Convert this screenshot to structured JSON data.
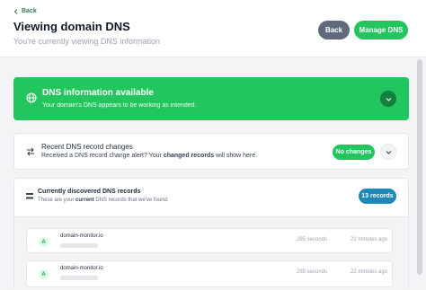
{
  "header": {
    "back_link": "Back",
    "title": "Viewing domain DNS",
    "subtitle": "You're currently viewing DNS information",
    "back_button": "Back",
    "manage_button": "Manage DNS"
  },
  "banner": {
    "title": "DNS information available",
    "text": "Your domain's DNS appears to be working as intended.",
    "color": "#22c55e",
    "icon": "globe-icon"
  },
  "changes": {
    "title": "Recent DNS record changes",
    "text_before": "Received a DNS record change alert? Your ",
    "text_bold": "changed records",
    "text_after": " will show here.",
    "pill": "No changes",
    "icon": "swap-arrows-icon"
  },
  "records": {
    "title": "Currently discovered DNS records",
    "text_before": "These are your ",
    "text_bold": "current",
    "text_after": " DNS records that we've found.",
    "count_pill": "13 records",
    "icon": "list-icon",
    "items": [
      {
        "type": "A",
        "host": "domain-monitor.io",
        "ttl": "285 seconds",
        "ago": "22 minutes ago"
      },
      {
        "type": "A",
        "host": "domain-monitor.io",
        "ttl": "285 seconds",
        "ago": "22 minutes ago"
      }
    ]
  }
}
